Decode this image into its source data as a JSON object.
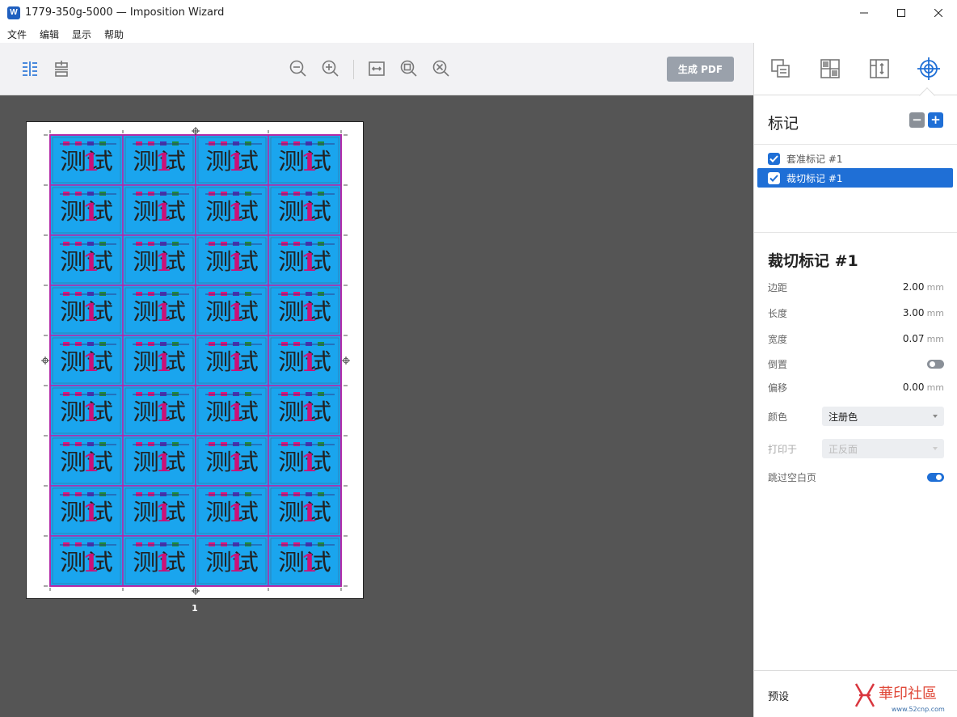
{
  "window": {
    "app_icon_text": "W",
    "title": "1779-350g-5000 — Imposition Wizard"
  },
  "menu": [
    "文件",
    "编辑",
    "显示",
    "帮助"
  ],
  "toolbar": {
    "generate_pdf": "生成 PDF"
  },
  "sheet": {
    "page_number": "1",
    "cols": 4,
    "rows": 9,
    "tile_text": "测试",
    "tile_digit": "1",
    "colors": {
      "tile_bg": "#1aa5ee",
      "tile_border": "#b32aa8",
      "text": "#222222",
      "digit": "#cc1177"
    }
  },
  "panel": {
    "marks_title": "标记",
    "minus": "−",
    "plus": "+",
    "marks": [
      {
        "label": "套准标记 #1",
        "checked": true,
        "selected": false
      },
      {
        "label": "裁切标记 #1",
        "checked": true,
        "selected": true
      }
    ],
    "props_title": "裁切标记 #1",
    "props": {
      "margin": {
        "label": "边距",
        "value": "2.00",
        "unit": "mm"
      },
      "length": {
        "label": "长度",
        "value": "3.00",
        "unit": "mm"
      },
      "width": {
        "label": "宽度",
        "value": "0.07",
        "unit": "mm"
      },
      "invert": {
        "label": "倒置",
        "on": false
      },
      "offset": {
        "label": "偏移",
        "value": "0.00",
        "unit": "mm"
      },
      "color": {
        "label": "颜色",
        "value": "注册色"
      },
      "print_on": {
        "label": "打印于",
        "value": "正反面"
      },
      "skip_blank": {
        "label": "跳过空白页",
        "on": true
      }
    },
    "preset_label": "预设",
    "watermark": {
      "text": "華印社區",
      "url": "www.52cnp.com"
    }
  },
  "accent": "#1f6fd6"
}
